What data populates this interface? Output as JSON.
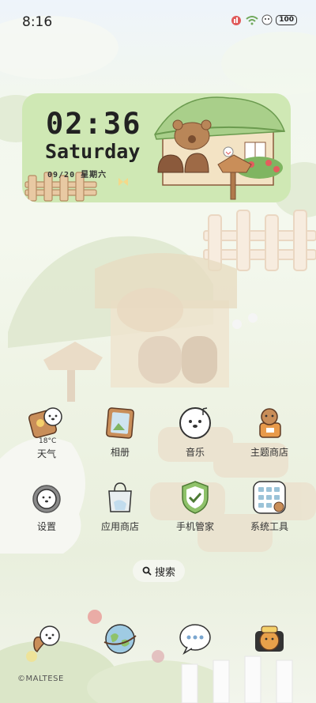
{
  "status_bar": {
    "time": "8:16",
    "battery": "100"
  },
  "widget": {
    "clock": "02:36",
    "weekday": "Saturday",
    "date": "09/20 星期六"
  },
  "apps": [
    {
      "label": "天气",
      "sub": "18°C",
      "icon": "weather-dog-icon"
    },
    {
      "label": "相册",
      "icon": "photo-frame-icon"
    },
    {
      "label": "音乐",
      "icon": "music-dog-icon"
    },
    {
      "label": "主题商店",
      "icon": "theme-store-dog-icon"
    },
    {
      "label": "设置",
      "icon": "settings-dog-gear-icon"
    },
    {
      "label": "应用商店",
      "icon": "app-store-bag-icon"
    },
    {
      "label": "手机管家",
      "icon": "phone-manager-shield-icon"
    },
    {
      "label": "系统工具",
      "icon": "system-tools-folder-icon"
    }
  ],
  "search": {
    "label": "搜索"
  },
  "dock": [
    {
      "icon": "phone-dog-icon"
    },
    {
      "icon": "browser-globe-icon"
    },
    {
      "icon": "messages-bubble-icon"
    },
    {
      "icon": "camera-dog-icon"
    }
  ],
  "copyright": "©MALTESE",
  "colors": {
    "widget_bg": "#cfe8b4",
    "accent_green": "#8fc26a",
    "roof": "#9bc57a",
    "wood": "#8b5a3c"
  }
}
